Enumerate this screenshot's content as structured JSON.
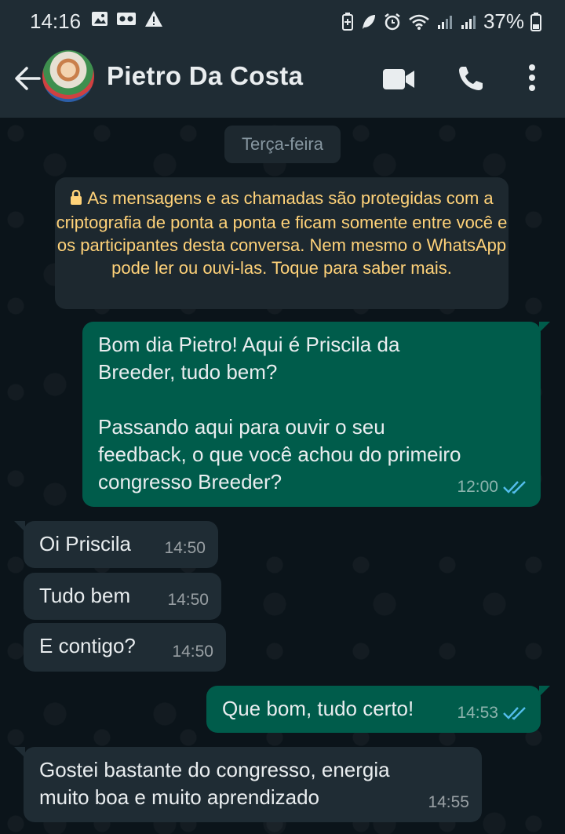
{
  "status_bar": {
    "time": "14:16",
    "battery": "37%"
  },
  "header": {
    "contact_name": "Pietro Da Costa",
    "icons": [
      "back-arrow-icon",
      "video-call-icon",
      "voice-call-icon",
      "more-options-icon"
    ]
  },
  "chat": {
    "day_separator": "Terça-feira",
    "encryption_notice": "As mensagens e as chamadas são protegidas com a criptografia de ponta a ponta e ficam somente entre você e os participantes desta conversa. Nem mesmo o WhatsApp pode ler ou ouvi-las. Toque para saber mais.",
    "messages": [
      {
        "direction": "outgoing",
        "text": "Bom dia Pietro! Aqui é Priscila da\nBreeder, tudo bem?\n\nPassando aqui para ouvir o seu\nfeedback, o que você achou do primeiro\ncongresso Breeder?",
        "time": "12:00",
        "status": "read"
      },
      {
        "direction": "incoming",
        "text": "Oi Priscila",
        "time": "14:50"
      },
      {
        "direction": "incoming",
        "text": "Tudo bem",
        "time": "14:50"
      },
      {
        "direction": "incoming",
        "text": "E contigo?",
        "time": "14:50"
      },
      {
        "direction": "outgoing",
        "text": "Que bom, tudo certo!",
        "time": "14:53",
        "status": "read"
      },
      {
        "direction": "incoming",
        "text": "Gostei bastante do congresso, energia\nmuito boa e muito aprendizado",
        "time": "14:55"
      }
    ]
  },
  "colors": {
    "background": "#0b141a",
    "header": "#1f2c34",
    "outgoing_bubble": "#005c4b",
    "incoming_bubble": "#1f2c34",
    "read_ticks": "#53bdeb",
    "encryption_text": "#ffd279"
  }
}
